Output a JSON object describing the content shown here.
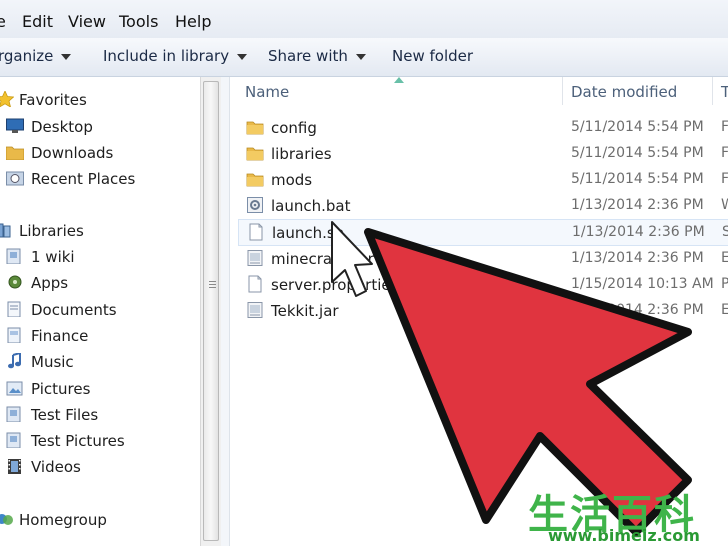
{
  "menubar": {
    "items": [
      "e",
      "Edit",
      "View",
      "Tools",
      "Help"
    ]
  },
  "toolbar": {
    "organize": "rganize",
    "include_in_library": "Include in library",
    "share_with": "Share with",
    "new_folder": "New folder"
  },
  "nav": {
    "favorites": {
      "label": "Favorites",
      "items": [
        "Desktop",
        "Downloads",
        "Recent Places"
      ]
    },
    "libraries": {
      "label": "Libraries",
      "items": [
        "1 wiki",
        "Apps",
        "Documents",
        "Finance",
        "Music",
        "Pictures",
        "Test Files",
        "Test Pictures",
        "Videos"
      ]
    },
    "homegroup": "Homegroup"
  },
  "columns": {
    "name": "Name",
    "date_modified": "Date modified",
    "type": "T"
  },
  "files": [
    {
      "name": "config",
      "date": "5/11/2014 5:54 PM",
      "type": "F",
      "icon": "folder-icon"
    },
    {
      "name": "libraries",
      "date": "5/11/2014 5:54 PM",
      "type": "F",
      "icon": "folder-icon"
    },
    {
      "name": "mods",
      "date": "5/11/2014 5:54 PM",
      "type": "F",
      "icon": "folder-icon"
    },
    {
      "name": "launch.bat",
      "date": "1/13/2014 2:36 PM",
      "type": "W",
      "icon": "batch-file-icon"
    },
    {
      "name": "launch.sh",
      "date": "1/13/2014 2:36 PM",
      "type": "S",
      "icon": "blank-file-icon"
    },
    {
      "name": "minecraft_server",
      "date": "1/13/2014 2:36 PM",
      "type": "E",
      "icon": "jar-file-icon"
    },
    {
      "name": "server.properties",
      "date": "1/15/2014 10:13 AM",
      "type": "P",
      "icon": "blank-file-icon"
    },
    {
      "name": "Tekkit.jar",
      "date": "1/13/2014 2:36 PM",
      "type": "E",
      "icon": "jar-file-icon"
    }
  ],
  "watermark": {
    "chars": "生活百科",
    "url": "www.bimeiz.com"
  },
  "colors": {
    "arrow": "#e0343f",
    "folder": "#e9b949",
    "watermark": "#3fb44a"
  }
}
